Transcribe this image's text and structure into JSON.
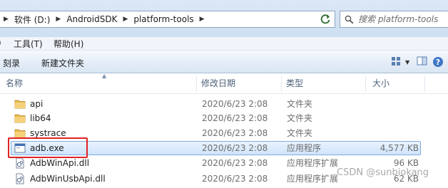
{
  "address_bar": {
    "breadcrumbs": [
      "软件 (D:)",
      "AndroidSDK",
      "platform-tools"
    ]
  },
  "search": {
    "placeholder": "搜索 platform-tools"
  },
  "menu": [
    "工具(T)",
    "帮助(H)"
  ],
  "commands": [
    "刻录",
    "新建文件夹"
  ],
  "columns": [
    "名称",
    "修改日期",
    "类型",
    "大小"
  ],
  "files": [
    {
      "name": "api",
      "date": "2020/6/23 2:08",
      "type": "文件夹",
      "size": "",
      "icon": "folder-icon"
    },
    {
      "name": "lib64",
      "date": "2020/6/23 2:08",
      "type": "文件夹",
      "size": "",
      "icon": "folder-icon"
    },
    {
      "name": "systrace",
      "date": "2020/6/23 2:08",
      "type": "文件夹",
      "size": "",
      "icon": "folder-icon"
    },
    {
      "name": "adb.exe",
      "date": "2020/6/23 2:08",
      "type": "应用程序",
      "size": "4,577 KB",
      "icon": "exe-icon"
    },
    {
      "name": "AdbWinApi.dll",
      "date": "2020/6/23 2:08",
      "type": "应用程序扩展",
      "size": "96 KB",
      "icon": "dll-icon"
    },
    {
      "name": "AdbWinUsbApi.dll",
      "date": "2020/6/23 2:08",
      "type": "应用程序扩展",
      "size": "62 KB",
      "icon": "dll-icon"
    }
  ],
  "selected_file": "adb.exe",
  "annotation": {
    "color": "#e02323",
    "target": "adb.exe"
  },
  "watermark": "CSDN @sunbiokang",
  "colors": {
    "selection": "#cfe4fb",
    "selection_border": "#84acdd"
  }
}
